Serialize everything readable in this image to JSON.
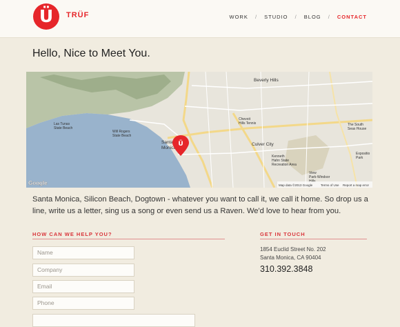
{
  "header": {
    "logo_mark": "Ü",
    "logo_text": "TRÜF",
    "nav": [
      {
        "label": "WORK",
        "active": false
      },
      {
        "label": "STUDIO",
        "active": false
      },
      {
        "label": "BLOG",
        "active": false
      },
      {
        "label": "CONTACT",
        "active": true
      }
    ],
    "separator": "/"
  },
  "main": {
    "heading": "Hello, Nice to Meet You.",
    "intro": "Santa Monica, Silicon Beach, Dogtown - whatever you want to call it, we call it home. So drop us a line, write us a letter, sing us a song or even send us a Raven. We'd love to hear from you."
  },
  "map": {
    "pin_label": "Ü",
    "labels": {
      "beverly_hills": "Beverly Hills",
      "las_tunas": "Las Tunas",
      "state_beach": "State Beach",
      "will_rogers": "Will Rogers",
      "state_beach2": "State Beach",
      "chevoit": "Chevoit",
      "hills_tennis": "Hills Tennis",
      "santa": "Santa",
      "monica": "Monica",
      "culver_city": "Culver City",
      "kenneth": "Kenneth",
      "hahn_state": "Hahn State",
      "recreation_area": "Recreation Area",
      "the_south": "The South",
      "seas_house": "Seas House",
      "view_park": "View",
      "park_windsor": "Park-Windsor",
      "hills": "Hills",
      "exposition": "Expositio",
      "park": "Park",
      "google": "Google",
      "map_data": "Map data ©2013 Google",
      "terms": "Terms of Use",
      "report": "Report a map error"
    }
  },
  "form": {
    "section_title": "HOW CAN WE HELP YOU?",
    "name_placeholder": "Name",
    "company_placeholder": "Company",
    "email_placeholder": "Email",
    "phone_placeholder": "Phone"
  },
  "contact": {
    "section_title": "GET IN TOUCH",
    "address_line1": "1854 Euclid Street No. 202",
    "address_line2": "Santa Monica, CA 90404",
    "phone": "310.392.3848"
  },
  "colors": {
    "accent": "#e6262a",
    "background": "#f1ece0",
    "header_bg": "#fbf9f4",
    "ocean": "#99b3cc"
  }
}
